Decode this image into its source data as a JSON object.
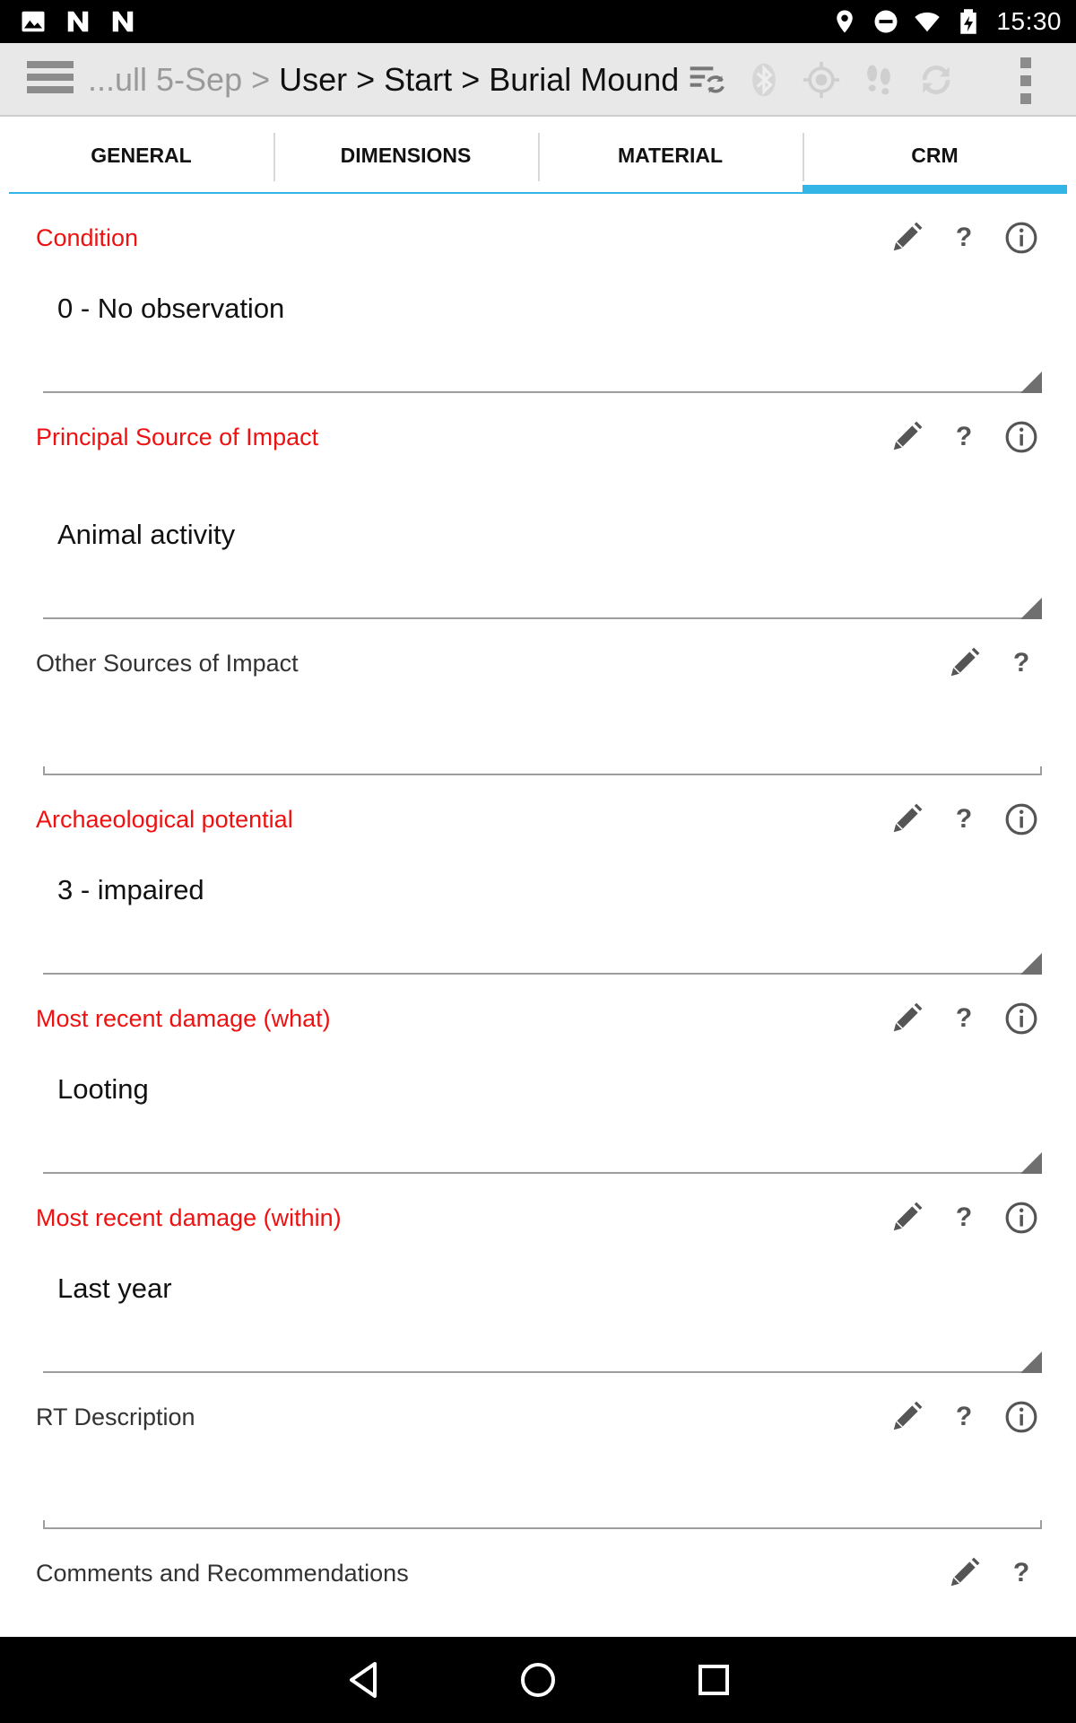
{
  "status_bar": {
    "time": "15:30",
    "left_icons": [
      "image-icon",
      "n-notification-icon",
      "n-notification-icon"
    ],
    "right_icons": [
      "location-icon",
      "do-not-disturb-icon",
      "wifi-icon",
      "battery-charging-icon"
    ]
  },
  "action_bar": {
    "breadcrumb_faded": "...ull 5-Sep > ",
    "breadcrumb_main": "User > Start > Burial Mound",
    "icons": [
      "sync-list-icon",
      "bluetooth-icon",
      "gps-target-icon",
      "footsteps-icon",
      "refresh-icon"
    ]
  },
  "tabs": [
    {
      "label": "GENERAL",
      "active": false
    },
    {
      "label": "DIMENSIONS",
      "active": false
    },
    {
      "label": "MATERIAL",
      "active": false
    },
    {
      "label": "CRM",
      "active": true
    }
  ],
  "fields": [
    {
      "label": "Condition",
      "required": true,
      "type": "spinner",
      "value": "0 - No observation",
      "icons": [
        "edit",
        "help",
        "info"
      ]
    },
    {
      "label": "Principal Source of Impact",
      "required": true,
      "type": "spinner",
      "value": "Animal activity",
      "icons": [
        "edit",
        "help",
        "info"
      ]
    },
    {
      "label": "Other Sources of Impact",
      "required": false,
      "type": "text",
      "value": "",
      "icons": [
        "edit",
        "help"
      ]
    },
    {
      "label": "Archaeological potential",
      "required": true,
      "type": "spinner",
      "value": "3 - impaired",
      "icons": [
        "edit",
        "help",
        "info"
      ]
    },
    {
      "label": "Most recent damage (what)",
      "required": true,
      "type": "spinner",
      "value": "Looting",
      "icons": [
        "edit",
        "help",
        "info"
      ]
    },
    {
      "label": "Most recent damage (within)",
      "required": true,
      "type": "spinner",
      "value": "Last year",
      "icons": [
        "edit",
        "help",
        "info"
      ]
    },
    {
      "label": "RT Description",
      "required": false,
      "type": "text",
      "value": "",
      "icons": [
        "edit",
        "help",
        "info"
      ]
    },
    {
      "label": "Comments and Recommendations",
      "required": false,
      "type": "text",
      "value": "",
      "icons": [
        "edit",
        "help"
      ]
    }
  ],
  "help_glyph": "?",
  "colors": {
    "required_label": "#ee1111",
    "tab_indicator": "#33b5e5",
    "action_bar_bg": "#e8e8e8"
  },
  "nav_bar": {
    "buttons": [
      "back-icon",
      "home-icon",
      "recents-icon"
    ]
  }
}
